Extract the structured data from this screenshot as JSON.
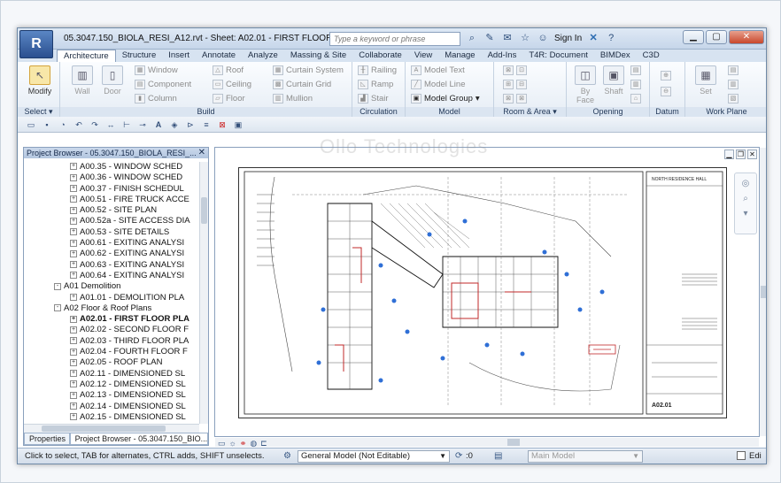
{
  "window": {
    "title": "05.3047.150_BIOLA_RESI_A12.rvt - Sheet: A02.01 - FIRST FLOOR P...",
    "app_letter": "R",
    "search_placeholder": "Type a keyword or phrase",
    "sign_in": "Sign In",
    "watermark": "Ollo Technologies"
  },
  "tabs": [
    "Architecture",
    "Structure",
    "Insert",
    "Annotate",
    "Analyze",
    "Massing & Site",
    "Collaborate",
    "View",
    "Manage",
    "Add-Ins",
    "T4R: Document",
    "BIMDex",
    "C3D"
  ],
  "ribbon": {
    "select": {
      "modify": "Modify",
      "label": "Select ▾"
    },
    "build": {
      "label": "Build",
      "wall": "Wall",
      "door": "Door",
      "window": "Window",
      "component": "Component",
      "column": "Column",
      "roof": "Roof",
      "ceiling": "Ceiling",
      "floor": "Floor",
      "curtain_system": "Curtain System",
      "curtain_grid": "Curtain Grid",
      "mullion": "Mullion"
    },
    "circulation": {
      "label": "Circulation",
      "railing": "Railing",
      "ramp": "Ramp",
      "stair": "Stair"
    },
    "model": {
      "label": "Model",
      "model_text": "Model Text",
      "model_line": "Model Line",
      "model_group": "Model Group"
    },
    "room_area": {
      "label": "Room & Area ▾"
    },
    "opening": {
      "label": "Opening",
      "by_face": "By Face",
      "shaft": "Shaft"
    },
    "datum": {
      "label": "Datum"
    },
    "work_plane": {
      "label": "Work Plane",
      "set": "Set"
    }
  },
  "project_browser": {
    "header": "Project Browser - 05.3047.150_BIOLA_RESI_...",
    "items": [
      {
        "indent": 2,
        "exp": "+",
        "text": "A00.35 - WINDOW SCHED",
        "bold": false
      },
      {
        "indent": 2,
        "exp": "+",
        "text": "A00.36 - WINDOW SCHED",
        "bold": false
      },
      {
        "indent": 2,
        "exp": "+",
        "text": "A00.37 - FINISH SCHEDUL",
        "bold": false
      },
      {
        "indent": 2,
        "exp": "+",
        "text": "A00.51 - FIRE TRUCK ACCE",
        "bold": false
      },
      {
        "indent": 2,
        "exp": "+",
        "text": "A00.52 - SITE PLAN",
        "bold": false
      },
      {
        "indent": 2,
        "exp": "+",
        "text": "A00.52a - SITE ACCESS DIA",
        "bold": false
      },
      {
        "indent": 2,
        "exp": "+",
        "text": "A00.53 - SITE DETAILS",
        "bold": false
      },
      {
        "indent": 2,
        "exp": "+",
        "text": "A00.61 - EXITING ANALYSI",
        "bold": false
      },
      {
        "indent": 2,
        "exp": "+",
        "text": "A00.62 - EXITING ANALYSI",
        "bold": false
      },
      {
        "indent": 2,
        "exp": "+",
        "text": "A00.63 - EXITING ANALYSI",
        "bold": false
      },
      {
        "indent": 2,
        "exp": "+",
        "text": "A00.64 - EXITING ANALYSI",
        "bold": false
      },
      {
        "indent": 1,
        "exp": "-",
        "text": "A01 Demolition",
        "bold": false
      },
      {
        "indent": 2,
        "exp": "+",
        "text": "A01.01 - DEMOLITION PLA",
        "bold": false
      },
      {
        "indent": 1,
        "exp": "-",
        "text": "A02 Floor & Roof Plans",
        "bold": false
      },
      {
        "indent": 2,
        "exp": "+",
        "text": "A02.01 - FIRST FLOOR PLA",
        "bold": true
      },
      {
        "indent": 2,
        "exp": "+",
        "text": "A02.02 - SECOND FLOOR F",
        "bold": false
      },
      {
        "indent": 2,
        "exp": "+",
        "text": "A02.03 - THIRD FLOOR PLA",
        "bold": false
      },
      {
        "indent": 2,
        "exp": "+",
        "text": "A02.04 - FOURTH FLOOR F",
        "bold": false
      },
      {
        "indent": 2,
        "exp": "+",
        "text": "A02.05 - ROOF PLAN",
        "bold": false
      },
      {
        "indent": 2,
        "exp": "+",
        "text": "A02.11 - DIMENSIONED SL",
        "bold": false
      },
      {
        "indent": 2,
        "exp": "+",
        "text": "A02.12 - DIMENSIONED SL",
        "bold": false
      },
      {
        "indent": 2,
        "exp": "+",
        "text": "A02.13 - DIMENSIONED SL",
        "bold": false
      },
      {
        "indent": 2,
        "exp": "+",
        "text": "A02.14 - DIMENSIONED SL",
        "bold": false
      },
      {
        "indent": 2,
        "exp": "+",
        "text": "A02.15 - DIMENSIONED SL",
        "bold": false
      }
    ],
    "tab_properties": "Properties",
    "tab_browser": "Project Browser - 05.3047.150_BIO..."
  },
  "sheet": {
    "title_block_heading": "NORTH RESIDENCE HALL",
    "sheet_number": "A02.01"
  },
  "status": {
    "message": "Click to select, TAB for alternates, CTRL adds, SHIFT unselects.",
    "workset": "General Model (Not Editable)",
    "count": ":0",
    "design_option": "Main Model",
    "editable_label": "Edi"
  }
}
